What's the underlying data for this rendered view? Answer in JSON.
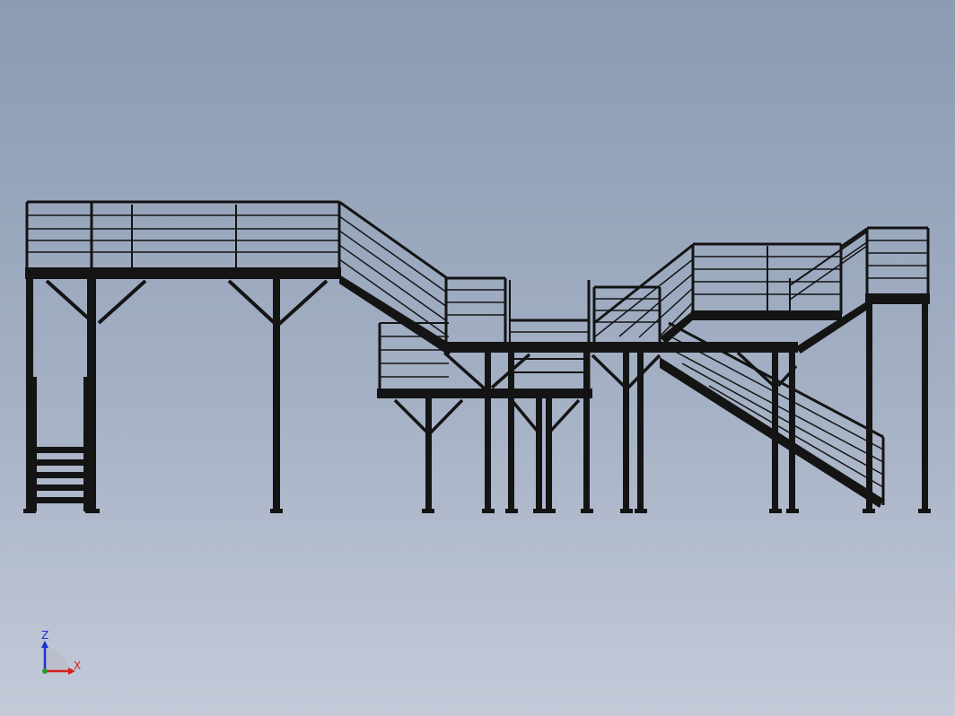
{
  "viewport": {
    "background": {
      "top": "#8a9bb3",
      "middle": "#a4b0c4",
      "bottom": "#c4cad8"
    },
    "model_color": "#141414"
  },
  "triad": {
    "z_label": "Z",
    "x_label": "X",
    "z_color": "#1f2fd6",
    "x_color": "#d42020",
    "origin_icon": "axis-origin-dot"
  }
}
